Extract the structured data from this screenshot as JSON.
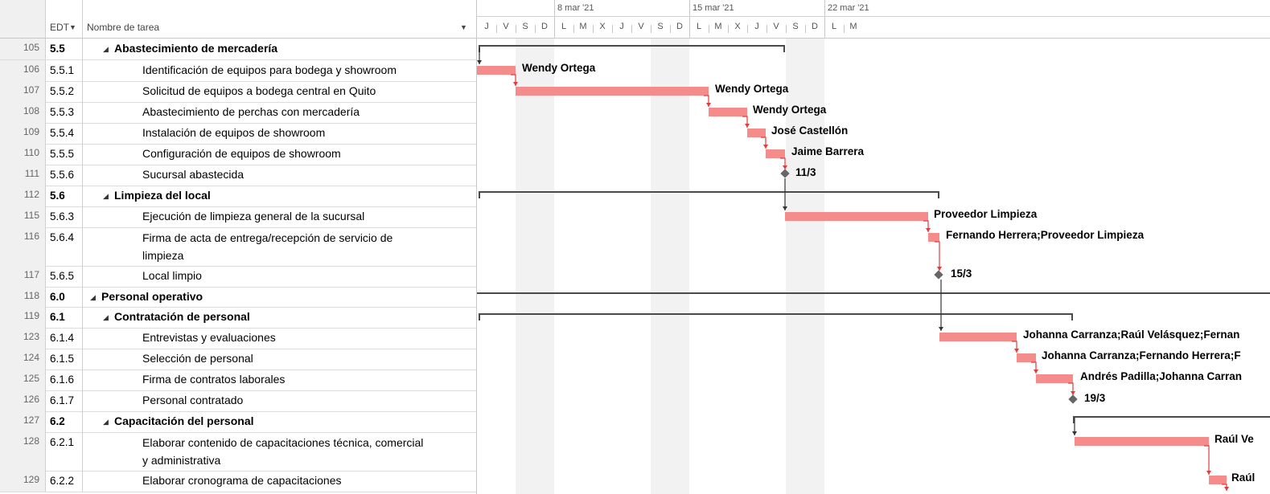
{
  "grid_header": {
    "wbs_label": "EDT",
    "name_label": "Nombre de tarea"
  },
  "rows": [
    {
      "id": "105",
      "wbs": "5.5",
      "name": "Abastecimiento de mercadería",
      "summary": true,
      "level": 2
    },
    {
      "id": "106",
      "wbs": "5.5.1",
      "name": "Identificación de equipos para bodega y showroom",
      "summary": false,
      "level": 3
    },
    {
      "id": "107",
      "wbs": "5.5.2",
      "name": "Solicitud de equipos a bodega central en Quito",
      "summary": false,
      "level": 3
    },
    {
      "id": "108",
      "wbs": "5.5.3",
      "name": "Abastecimiento de perchas con mercadería",
      "summary": false,
      "level": 3
    },
    {
      "id": "109",
      "wbs": "5.5.4",
      "name": "Instalación de equipos de showroom",
      "summary": false,
      "level": 3
    },
    {
      "id": "110",
      "wbs": "5.5.5",
      "name": "Configuración de equipos de showroom",
      "summary": false,
      "level": 3
    },
    {
      "id": "111",
      "wbs": "5.5.6",
      "name": "Sucursal abastecida",
      "summary": false,
      "level": 3
    },
    {
      "id": "112",
      "wbs": "5.6",
      "name": "Limpieza del local",
      "summary": true,
      "level": 2
    },
    {
      "id": "115",
      "wbs": "5.6.3",
      "name": "Ejecución de limpieza general de la sucursal",
      "summary": false,
      "level": 3
    },
    {
      "id": "116",
      "wbs": "5.6.4",
      "name": "Firma de acta de entrega/recepción de servicio de",
      "name2": "limpieza",
      "summary": false,
      "level": 3
    },
    {
      "id": "117",
      "wbs": "5.6.5",
      "name": "Local limpio",
      "summary": false,
      "level": 3
    },
    {
      "id": "118",
      "wbs": "6.0",
      "name": "Personal operativo",
      "summary": true,
      "level": 1
    },
    {
      "id": "119",
      "wbs": "6.1",
      "name": "Contratación de personal",
      "summary": true,
      "level": 2
    },
    {
      "id": "123",
      "wbs": "6.1.4",
      "name": "Entrevistas y evaluaciones",
      "summary": false,
      "level": 3
    },
    {
      "id": "124",
      "wbs": "6.1.5",
      "name": "Selección de personal",
      "summary": false,
      "level": 3
    },
    {
      "id": "125",
      "wbs": "6.1.6",
      "name": "Firma de contratos laborales",
      "summary": false,
      "level": 3
    },
    {
      "id": "126",
      "wbs": "6.1.7",
      "name": "Personal contratado",
      "summary": false,
      "level": 3
    },
    {
      "id": "127",
      "wbs": "6.2",
      "name": "Capacitación del personal",
      "summary": true,
      "level": 2
    },
    {
      "id": "128",
      "wbs": "6.2.1",
      "name": "Elaborar contenido de capacitaciones técnica, comercial",
      "name2": "y administrativa",
      "summary": false,
      "level": 3
    },
    {
      "id": "129",
      "wbs": "6.2.2",
      "name": "Elaborar cronograma de capacitaciones",
      "summary": false,
      "level": 3
    }
  ],
  "timescale": {
    "weeks": [
      "8 mar '21",
      "15 mar '21",
      "22 mar '21"
    ],
    "days": [
      "J",
      "V",
      "S",
      "D",
      "L",
      "M",
      "X",
      "J",
      "V",
      "S",
      "D",
      "L",
      "M",
      "X",
      "J",
      "V",
      "S",
      "D",
      "L",
      "M"
    ]
  },
  "gantt_labels": [
    "Wendy Ortega",
    "Wendy Ortega",
    "Wendy Ortega",
    "José Castellón",
    "Jaime Barrera",
    "11/3",
    "Proveedor Limpieza",
    "Fernando Herrera;Proveedor Limpieza",
    "15/3",
    "Johanna Carranza;Raúl Velásquez;Fernan",
    "Johanna Carranza;Fernando Herrera;F",
    "Andrés Padilla;Johanna Carran",
    "19/3",
    "Raúl Ve",
    "Raúl"
  ],
  "colors": {
    "task_bar": "#f48c8c",
    "summary_bar": "#4a4a4a",
    "link": "#e03c3c",
    "weekend_shade": "#f2f2f2"
  }
}
